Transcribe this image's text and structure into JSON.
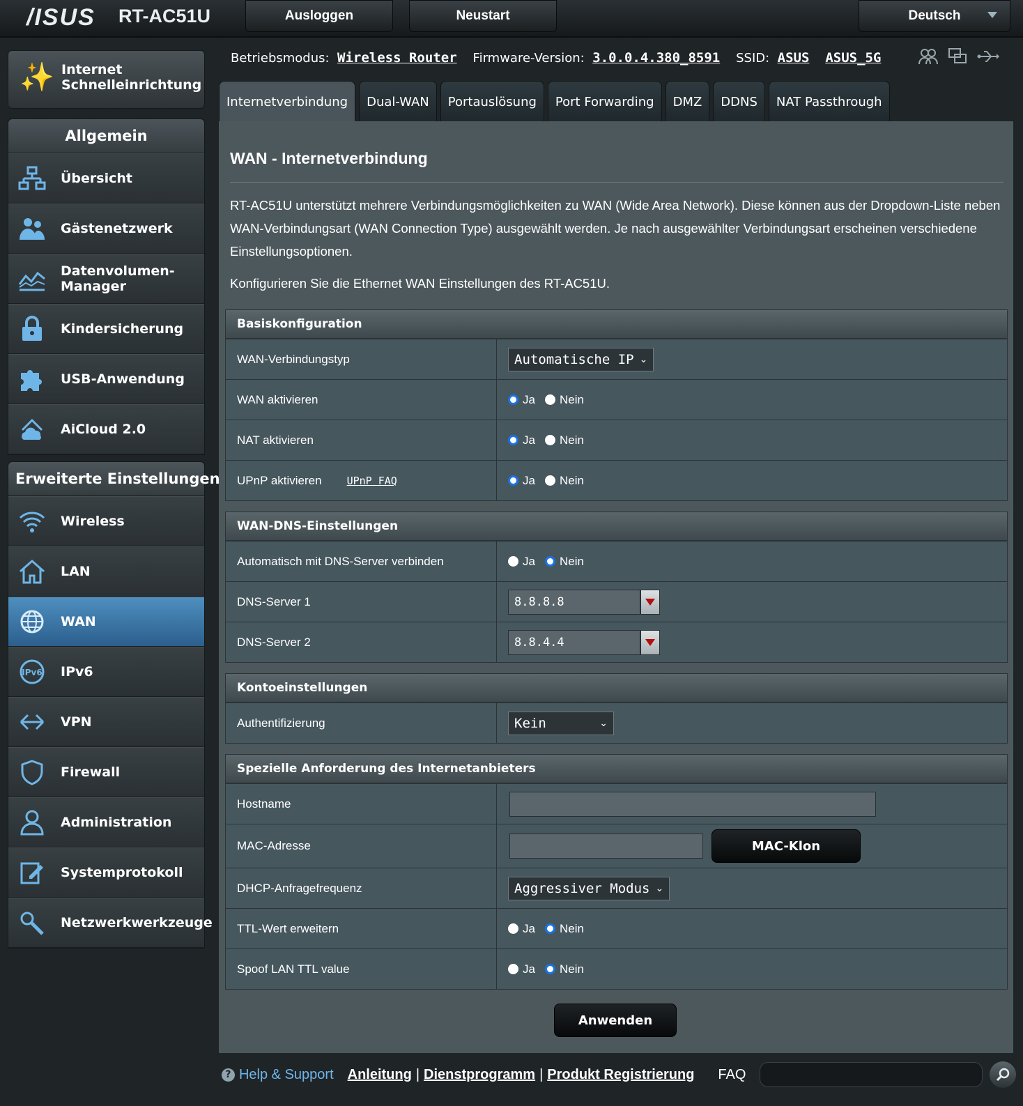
{
  "header": {
    "brand": "/ISUS",
    "model": "RT-AC51U",
    "logout_label": "Ausloggen",
    "reboot_label": "Neustart",
    "language": "Deutsch"
  },
  "sidebar": {
    "qis_label_1": "Internet",
    "qis_label_2": "Schnelleinrichtung",
    "general_title": "Allgemein",
    "general_items": [
      {
        "label": "Übersicht",
        "icon": "network-map-icon"
      },
      {
        "label": "Gästenetzwerk",
        "icon": "guest-network-icon"
      },
      {
        "label_1": "Datenvolumen-",
        "label_2": "Manager",
        "icon": "traffic-manager-icon"
      },
      {
        "label": "Kindersicherung",
        "icon": "lock-icon"
      },
      {
        "label": "USB-Anwendung",
        "icon": "puzzle-icon"
      },
      {
        "label": "AiCloud 2.0",
        "icon": "cloud-icon"
      }
    ],
    "advanced_title": "Erweiterte Einstellungen",
    "advanced_items": [
      {
        "label": "Wireless",
        "icon": "wifi-icon"
      },
      {
        "label": "LAN",
        "icon": "home-icon"
      },
      {
        "label": "WAN",
        "icon": "globe-icon",
        "active": true
      },
      {
        "label": "IPv6",
        "icon": "ipv6-icon"
      },
      {
        "label": "VPN",
        "icon": "vpn-icon"
      },
      {
        "label": "Firewall",
        "icon": "shield-icon"
      },
      {
        "label": "Administration",
        "icon": "user-icon"
      },
      {
        "label": "Systemprotokoll",
        "icon": "log-icon"
      },
      {
        "label": "Netzwerkwerkzeuge",
        "icon": "tools-icon"
      }
    ]
  },
  "status": {
    "mode_key": "Betriebsmodus:",
    "mode_value": "Wireless Router",
    "fw_key": "Firmware-Version:",
    "fw_value": "3.0.0.4.380_8591",
    "ssid_key": "SSID:",
    "ssid_1": "ASUS",
    "ssid_2": "ASUS_5G"
  },
  "tabs": [
    "Internetverbindung",
    "Dual-WAN",
    "Portauslösung",
    "Port Forwarding",
    "DMZ",
    "DDNS",
    "NAT Passthrough"
  ],
  "page": {
    "title": "WAN - Internetverbindung",
    "description": "RT-AC51U unterstützt mehrere Verbindungsmöglichkeiten zu WAN (Wide Area Network). Diese können aus der Dropdown-Liste neben WAN-Verbindungsart (WAN Connection Type) ausgewählt werden. Je nach ausgewählter Verbindungsart erscheinen verschiedene Einstellungsoptionen.",
    "description2": "Konfigurieren Sie die Ethernet WAN Einstellungen des RT-AC51U.",
    "yes": "Ja",
    "no": "Nein"
  },
  "basic": {
    "header": "Basiskonfiguration",
    "wan_type_label": "WAN-Verbindungstyp",
    "wan_type_value": "Automatische IP",
    "wan_enable_label": "WAN aktivieren",
    "nat_enable_label": "NAT aktivieren",
    "upnp_label": "UPnP aktivieren",
    "upnp_faq": "UPnP FAQ"
  },
  "dns": {
    "header": "WAN-DNS-Einstellungen",
    "auto_label": "Automatisch mit DNS-Server verbinden",
    "dns1_label": "DNS-Server 1",
    "dns1_value": "8.8.8.8",
    "dns2_label": "DNS-Server 2",
    "dns2_value": "8.8.4.4"
  },
  "account": {
    "header": "Kontoeinstellungen",
    "auth_label": "Authentifizierung",
    "auth_value": "Kein"
  },
  "isp": {
    "header": "Spezielle Anforderung des Internetanbieters",
    "hostname_label": "Hostname",
    "hostname_value": "",
    "mac_label": "MAC-Adresse",
    "mac_value": "",
    "mac_clone": "MAC-Klon",
    "dhcp_label": "DHCP-Anfragefrequenz",
    "dhcp_value": "Aggressiver Modus",
    "ttl_label": "TTL-Wert erweitern",
    "spoof_label": "Spoof LAN TTL value"
  },
  "apply_label": "Anwenden",
  "footer": {
    "help": "Help & Support",
    "link1": "Anleitung",
    "link2": "Dienstprogramm",
    "link3": "Produkt Registrierung",
    "faq": "FAQ"
  },
  "colors": {
    "accent": "#6fb6e8",
    "active_nav": "#3d79a8",
    "panel": "#4d585d",
    "radio_on": "#1a73e8"
  }
}
